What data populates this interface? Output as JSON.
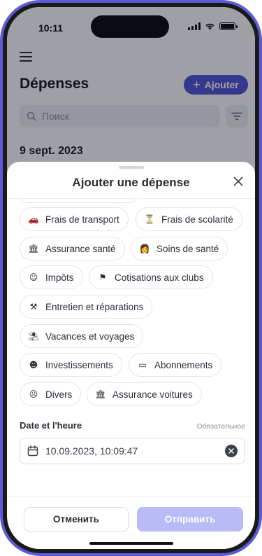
{
  "status_bar": {
    "time": "10:11"
  },
  "header": {
    "title": "Dépenses",
    "add_button_label": "Ajouter"
  },
  "search": {
    "placeholder": "Поиск"
  },
  "list": {
    "date_heading": "9 sept. 2023"
  },
  "sheet": {
    "title": "Ajouter une dépense",
    "categories": [
      {
        "label": "Frais de transport",
        "icon": "car-icon",
        "emoji": "🚗"
      },
      {
        "label": "Frais de scolarité",
        "icon": "hourglass-icon",
        "emoji": "⏳"
      },
      {
        "label": "Assurance santé",
        "icon": "bank-icon",
        "emoji": "🏛"
      },
      {
        "label": "Soins de santé",
        "icon": "doctor-icon",
        "emoji": "👩"
      },
      {
        "label": "Impôts",
        "icon": "smile-icon",
        "emoji": "☺"
      },
      {
        "label": "Cotisations aux clubs",
        "icon": "flag-icon",
        "emoji": "⚑"
      },
      {
        "label": "Entretien et réparations",
        "icon": "tools-icon",
        "emoji": "⚒"
      },
      {
        "label": "Vacances et voyages",
        "icon": "beach-icon",
        "emoji": "⛱"
      },
      {
        "label": "Investissements",
        "icon": "money-face-icon",
        "emoji": "☻"
      },
      {
        "label": "Abonnements",
        "icon": "ticket-icon",
        "emoji": "▭"
      },
      {
        "label": "Divers",
        "icon": "thinking-face-icon",
        "emoji": "☹"
      },
      {
        "label": "Assurance voitures",
        "icon": "bank-icon",
        "emoji": "🏛"
      }
    ],
    "date_field": {
      "label": "Date et l'heure",
      "required": "Обязательное",
      "value": "10.09.2023, 10:09:47"
    },
    "cancel_label": "Отменить",
    "submit_label": "Отправить"
  },
  "colors": {
    "accent": "#4b4ed6",
    "frame": "#5b5bd9",
    "submit_disabled": "#b8bbf5"
  }
}
